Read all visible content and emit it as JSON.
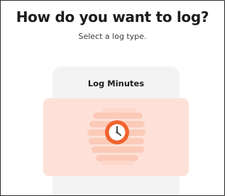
{
  "header": {
    "title": "How do you want to log?",
    "subtitle": "Select a log type."
  },
  "options": [
    {
      "label": "Log Minutes",
      "icon": "clock-icon"
    }
  ],
  "colors": {
    "title": "#1c1c1c",
    "card_background": "#f3f3f3",
    "illustration_background": "#fde1d8",
    "clock_orange": "#f0632d",
    "clock_face": "#ffffff"
  }
}
